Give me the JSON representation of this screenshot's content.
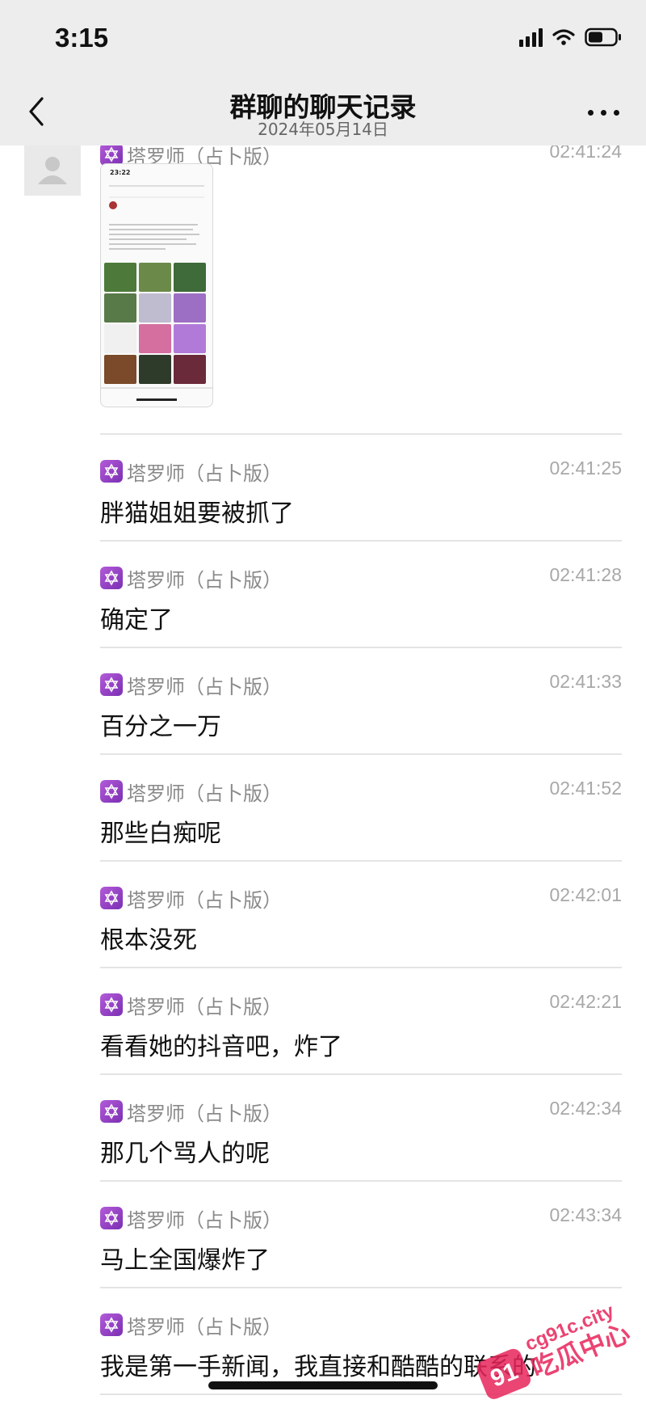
{
  "status": {
    "time": "3:15"
  },
  "nav": {
    "title": "群聊的聊天记录",
    "subtitle": "2024年05月14日"
  },
  "image_message": {
    "sender": "塔罗师（占卜版）",
    "time": "02:41:24",
    "thumbnail": {
      "time": "23:22"
    }
  },
  "messages": [
    {
      "sender": "塔罗师（占卜版）",
      "time": "02:41:25",
      "text": "胖猫姐姐要被抓了"
    },
    {
      "sender": "塔罗师（占卜版）",
      "time": "02:41:28",
      "text": "确定了"
    },
    {
      "sender": "塔罗师（占卜版）",
      "time": "02:41:33",
      "text": "百分之一万"
    },
    {
      "sender": "塔罗师（占卜版）",
      "time": "02:41:52",
      "text": "那些白痴呢"
    },
    {
      "sender": "塔罗师（占卜版）",
      "time": "02:42:01",
      "text": "根本没死"
    },
    {
      "sender": "塔罗师（占卜版）",
      "time": "02:42:21",
      "text": "看看她的抖音吧，炸了"
    },
    {
      "sender": "塔罗师（占卜版）",
      "time": "02:42:34",
      "text": "那几个骂人的呢"
    },
    {
      "sender": "塔罗师（占卜版）",
      "time": "02:43:34",
      "text": "马上全国爆炸了"
    },
    {
      "sender": "塔罗师（占卜版）",
      "time": "",
      "text": "我是第一手新闻，我直接和酷酷的联系的"
    }
  ],
  "watermark": {
    "site": "cg91c.city",
    "brand": "吃瓜中心",
    "logo": "91"
  },
  "colors": {
    "bar": "#ededed",
    "app_icon": "#9b45c9",
    "watermark": "#e8245a"
  }
}
